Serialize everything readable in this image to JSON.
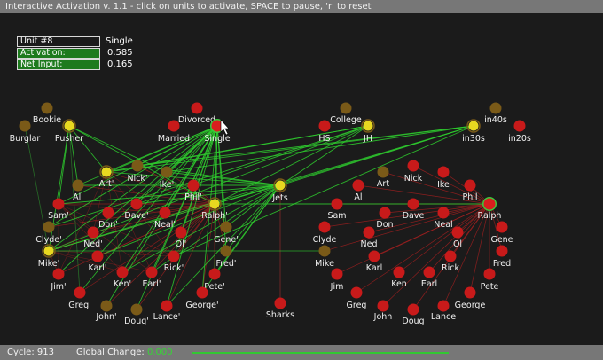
{
  "window": {
    "title": "Interactive Activation v. 1.1 - click on units to activate, SPACE to pause, 'r' to reset"
  },
  "info_panel": {
    "unit_label": "Unit #8",
    "unit_value": "Single",
    "activation_label": "Activation:",
    "activation_value": "0.585",
    "net_input_label": "Net Input:",
    "net_input_value": "0.165"
  },
  "status": {
    "cycle": "Cycle: 913",
    "global_change_label": "Global Change:",
    "global_change_value": "0.000"
  },
  "colors": {
    "background": "#1b1b1b",
    "excitatory": "#2ecc2e",
    "inhibitory": "#b02020",
    "unit_red": "#c81a1a",
    "unit_yellow": "#e8d820"
  },
  "units": [
    {
      "id": "bookie",
      "label": "Bookie",
      "state": "dim"
    },
    {
      "id": "burglar",
      "label": "Burglar",
      "state": "dim"
    },
    {
      "id": "pusher",
      "label": "Pusher",
      "state": "yellow"
    },
    {
      "id": "divorced",
      "label": "Divorced",
      "state": "red"
    },
    {
      "id": "married",
      "label": "Married",
      "state": "red"
    },
    {
      "id": "single",
      "label": "Single",
      "state": "active"
    },
    {
      "id": "college",
      "label": "College",
      "state": "dim"
    },
    {
      "id": "hs",
      "label": "HS",
      "state": "red"
    },
    {
      "id": "jh",
      "label": "JH",
      "state": "yellow"
    },
    {
      "id": "in40s",
      "label": "in40s",
      "state": "dim"
    },
    {
      "id": "in30s",
      "label": "in30s",
      "state": "yellow"
    },
    {
      "id": "in20s",
      "label": "in20s",
      "state": "red"
    },
    {
      "id": "art_i",
      "label": "Art'",
      "state": "yellow"
    },
    {
      "id": "nick_i",
      "label": "Nick'",
      "state": "dim"
    },
    {
      "id": "ike_i",
      "label": "Ike'",
      "state": "dim"
    },
    {
      "id": "al_i",
      "label": "Al'",
      "state": "dim"
    },
    {
      "id": "phil_i",
      "label": "Phil'",
      "state": "red"
    },
    {
      "id": "sam_i",
      "label": "Sam'",
      "state": "red"
    },
    {
      "id": "don_i",
      "label": "Don'",
      "state": "red"
    },
    {
      "id": "dave_i",
      "label": "Dave'",
      "state": "red"
    },
    {
      "id": "neal_i",
      "label": "Neal'",
      "state": "red"
    },
    {
      "id": "ralph_i",
      "label": "Ralph'",
      "state": "yellow"
    },
    {
      "id": "jets",
      "label": "Jets",
      "state": "yellow"
    },
    {
      "id": "clyde_i",
      "label": "Clyde'",
      "state": "dim"
    },
    {
      "id": "ned_i",
      "label": "Ned'",
      "state": "red"
    },
    {
      "id": "ol_i",
      "label": "Ol'",
      "state": "red"
    },
    {
      "id": "gene_i",
      "label": "Gene'",
      "state": "dim"
    },
    {
      "id": "mike_i",
      "label": "Mike'",
      "state": "yellow"
    },
    {
      "id": "karl_i",
      "label": "Karl'",
      "state": "red"
    },
    {
      "id": "rick_i",
      "label": "Rick'",
      "state": "red"
    },
    {
      "id": "fred_i",
      "label": "Fred'",
      "state": "dim"
    },
    {
      "id": "jim_i",
      "label": "Jim'",
      "state": "red"
    },
    {
      "id": "ken_i",
      "label": "Ken'",
      "state": "red"
    },
    {
      "id": "earl_i",
      "label": "Earl'",
      "state": "red"
    },
    {
      "id": "pete_i",
      "label": "Pete'",
      "state": "red"
    },
    {
      "id": "greg_i",
      "label": "Greg'",
      "state": "red"
    },
    {
      "id": "george_i",
      "label": "George'",
      "state": "red"
    },
    {
      "id": "john_i",
      "label": "John'",
      "state": "dim"
    },
    {
      "id": "doug_i",
      "label": "Doug'",
      "state": "dim"
    },
    {
      "id": "lance_i",
      "label": "Lance'",
      "state": "red"
    },
    {
      "id": "sharks",
      "label": "Sharks",
      "state": "red"
    },
    {
      "id": "al",
      "label": "Al",
      "state": "red"
    },
    {
      "id": "art",
      "label": "Art",
      "state": "dim"
    },
    {
      "id": "nick",
      "label": "Nick",
      "state": "red"
    },
    {
      "id": "ike",
      "label": "Ike",
      "state": "red"
    },
    {
      "id": "phil",
      "label": "Phil",
      "state": "red"
    },
    {
      "id": "sam",
      "label": "Sam",
      "state": "red"
    },
    {
      "id": "don",
      "label": "Don",
      "state": "red"
    },
    {
      "id": "dave",
      "label": "Dave",
      "state": "red"
    },
    {
      "id": "neal",
      "label": "Neal",
      "state": "red"
    },
    {
      "id": "ralph",
      "label": "Ralph",
      "state": "active"
    },
    {
      "id": "clyde",
      "label": "Clyde",
      "state": "red"
    },
    {
      "id": "ned",
      "label": "Ned",
      "state": "red"
    },
    {
      "id": "ol",
      "label": "Ol",
      "state": "red"
    },
    {
      "id": "gene",
      "label": "Gene",
      "state": "red"
    },
    {
      "id": "mike",
      "label": "Mike",
      "state": "dim"
    },
    {
      "id": "karl",
      "label": "Karl",
      "state": "red"
    },
    {
      "id": "rick",
      "label": "Rick",
      "state": "red"
    },
    {
      "id": "fred",
      "label": "Fred",
      "state": "red"
    },
    {
      "id": "jim",
      "label": "Jim",
      "state": "red"
    },
    {
      "id": "ken",
      "label": "Ken",
      "state": "red"
    },
    {
      "id": "earl",
      "label": "Earl",
      "state": "red"
    },
    {
      "id": "pete",
      "label": "Pete",
      "state": "red"
    },
    {
      "id": "greg",
      "label": "Greg",
      "state": "red"
    },
    {
      "id": "john",
      "label": "John",
      "state": "red"
    },
    {
      "id": "doug",
      "label": "Doug",
      "state": "red"
    },
    {
      "id": "lance",
      "label": "Lance",
      "state": "red"
    },
    {
      "id": "george",
      "label": "George",
      "state": "red"
    }
  ]
}
